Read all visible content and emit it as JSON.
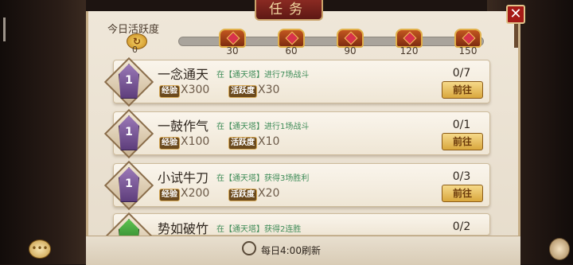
{
  "title": "任务",
  "activity": {
    "label": "今日活跃度",
    "value": "0",
    "milestones": [
      "30",
      "60",
      "90",
      "120",
      "150"
    ]
  },
  "labels": {
    "exp": "经验",
    "activity": "活跃度",
    "go": "前往"
  },
  "tasks": [
    {
      "name": "一念通天",
      "desc": "在【通天塔】进行7场战斗",
      "exp": "X300",
      "act": "X30",
      "progress": "0/7",
      "badge": "1"
    },
    {
      "name": "一鼓作气",
      "desc": "在【通天塔】进行1场战斗",
      "exp": "X100",
      "act": "X10",
      "progress": "0/1",
      "badge": "1"
    },
    {
      "name": "小试牛刀",
      "desc": "在【通天塔】获得3场胜利",
      "exp": "X200",
      "act": "X20",
      "progress": "0/3",
      "badge": "1"
    },
    {
      "name": "势如破竹",
      "desc": "在【通天塔】获得2连胜",
      "progress": "0/2"
    }
  ],
  "footer": {
    "refresh": "每日4:00刷新"
  }
}
